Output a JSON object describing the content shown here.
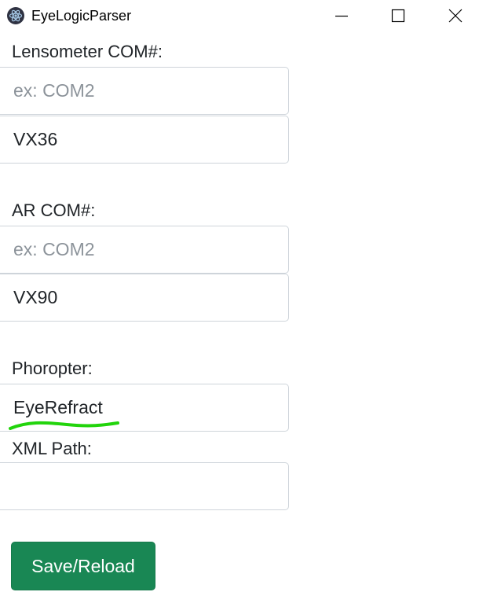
{
  "window": {
    "title": "EyeLogicParser",
    "controls": {
      "minimize": "minimize-icon",
      "maximize": "maximize-icon",
      "close": "close-icon"
    }
  },
  "form": {
    "lensometer": {
      "label": "Lensometer COM#:",
      "com_placeholder": "ex: COM2",
      "com_value": "",
      "model_value": "VX36"
    },
    "ar": {
      "label": "AR COM#:",
      "com_placeholder": "ex: COM2",
      "com_value": "",
      "model_value": "VX90"
    },
    "phoropter": {
      "label": "Phoropter:",
      "value": "EyeRefract"
    },
    "xml_path": {
      "label": "XML Path:",
      "value": ""
    },
    "save_button_label": "Save/Reload"
  },
  "colors": {
    "primary_button": "#198754",
    "annotation_underline": "#22d40c",
    "input_border": "#ced4da",
    "placeholder": "#8c939a"
  }
}
